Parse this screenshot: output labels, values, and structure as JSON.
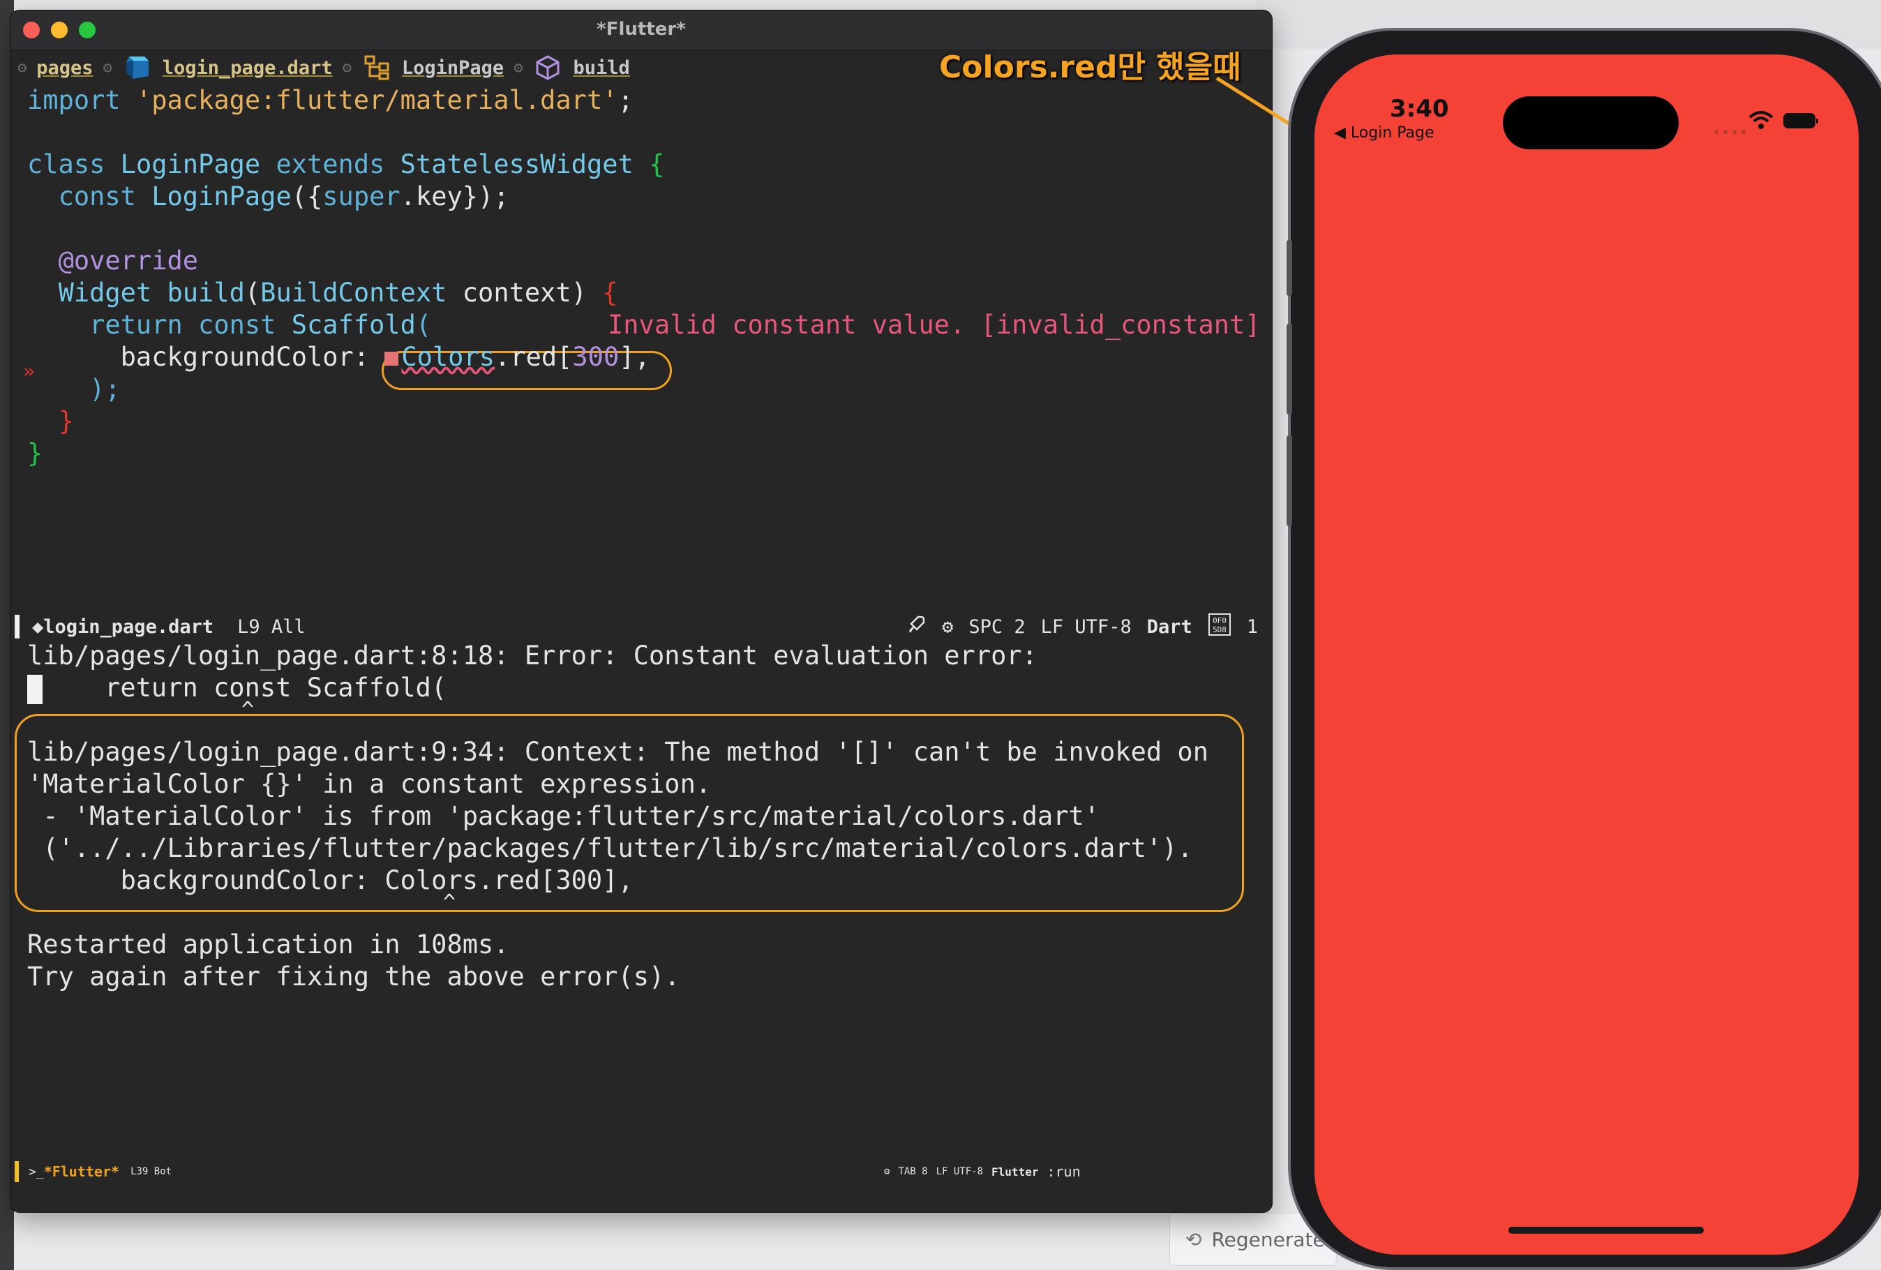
{
  "window": {
    "title": "*Flutter*"
  },
  "breadcrumb": {
    "items": [
      {
        "label": "pages",
        "icon": "folder-icon"
      },
      {
        "label": "login_page.dart",
        "icon": "dart-logo-icon"
      },
      {
        "label": "LoginPage",
        "icon": "class-icon"
      },
      {
        "label": "build",
        "icon": "method-cube-icon"
      }
    ]
  },
  "code": {
    "l1_import": "import",
    "l1_str": "'package:flutter/material.dart'",
    "l1_end": ";",
    "l3_class": "class",
    "l3_name": "LoginPage",
    "l3_extends": "extends",
    "l3_super": "StatelessWidget",
    "l3_brace": "{",
    "l4_const": "const",
    "l4_name": "LoginPage",
    "l4_open": "({",
    "l4_super": "super",
    "l4_key": ".key",
    "l4_close": "});",
    "l6_ann": "@override",
    "l7_type": "Widget",
    "l7_fn": "build",
    "l7_open": "(",
    "l7_ptype": "BuildContext",
    "l7_param": "context",
    "l7_close": ")",
    "l7_brace": "{",
    "l8_return": "return",
    "l8_const": "const",
    "l8_fn": "Scaffold",
    "l8_open": "(",
    "l8_error": "Invalid constant value. [invalid_constant]",
    "l9_prop": "backgroundColor:",
    "l9_cls": "Colors",
    "l9_field": ".red[",
    "l9_num": "300",
    "l9_close": "],",
    "l10_close": ");",
    "l11_brace": "}",
    "l12_brace": "}",
    "fringe_marker": "»"
  },
  "modeline_top": {
    "filename": "login_page.dart",
    "position": "L9 All",
    "indent": "SPC 2",
    "encoding": "LF UTF-8",
    "mode": "Dart",
    "count": "1"
  },
  "output": {
    "line1": "lib/pages/login_page.dart:8:18: Error: Constant evaluation error:",
    "line2": "    return const Scaffold(",
    "line3": "                 ^",
    "line4": "lib/pages/login_page.dart:9:34: Context: The method '[]' can't be invoked on",
    "line5": "'MaterialColor {}' in a constant expression.",
    "line6": " - 'MaterialColor' is from 'package:flutter/src/material/colors.dart'",
    "line7": " ('../../Libraries/flutter/packages/flutter/lib/src/material/colors.dart').",
    "line8": "      backgroundColor: Colors.red[300],",
    "line9": "                                 ^",
    "line10": "Restarted application in 108ms.",
    "line11": "Try again after fixing the above error(s)."
  },
  "modeline_bottom": {
    "prompt": ">_",
    "buffer": "*Flutter*",
    "position": "L39 Bot",
    "indent": "TAB 8",
    "encoding": "LF UTF-8",
    "mode": "Flutter",
    "process": ":run"
  },
  "annotation": {
    "text": "Colors.red만 했을때",
    "color": "#f5a320"
  },
  "phone": {
    "time": "3:40",
    "back_label": "◀ Login Page",
    "signal_dots": "••••",
    "screen_color": "#f44336"
  },
  "background": {
    "regenerate_label": "Regenerate"
  }
}
